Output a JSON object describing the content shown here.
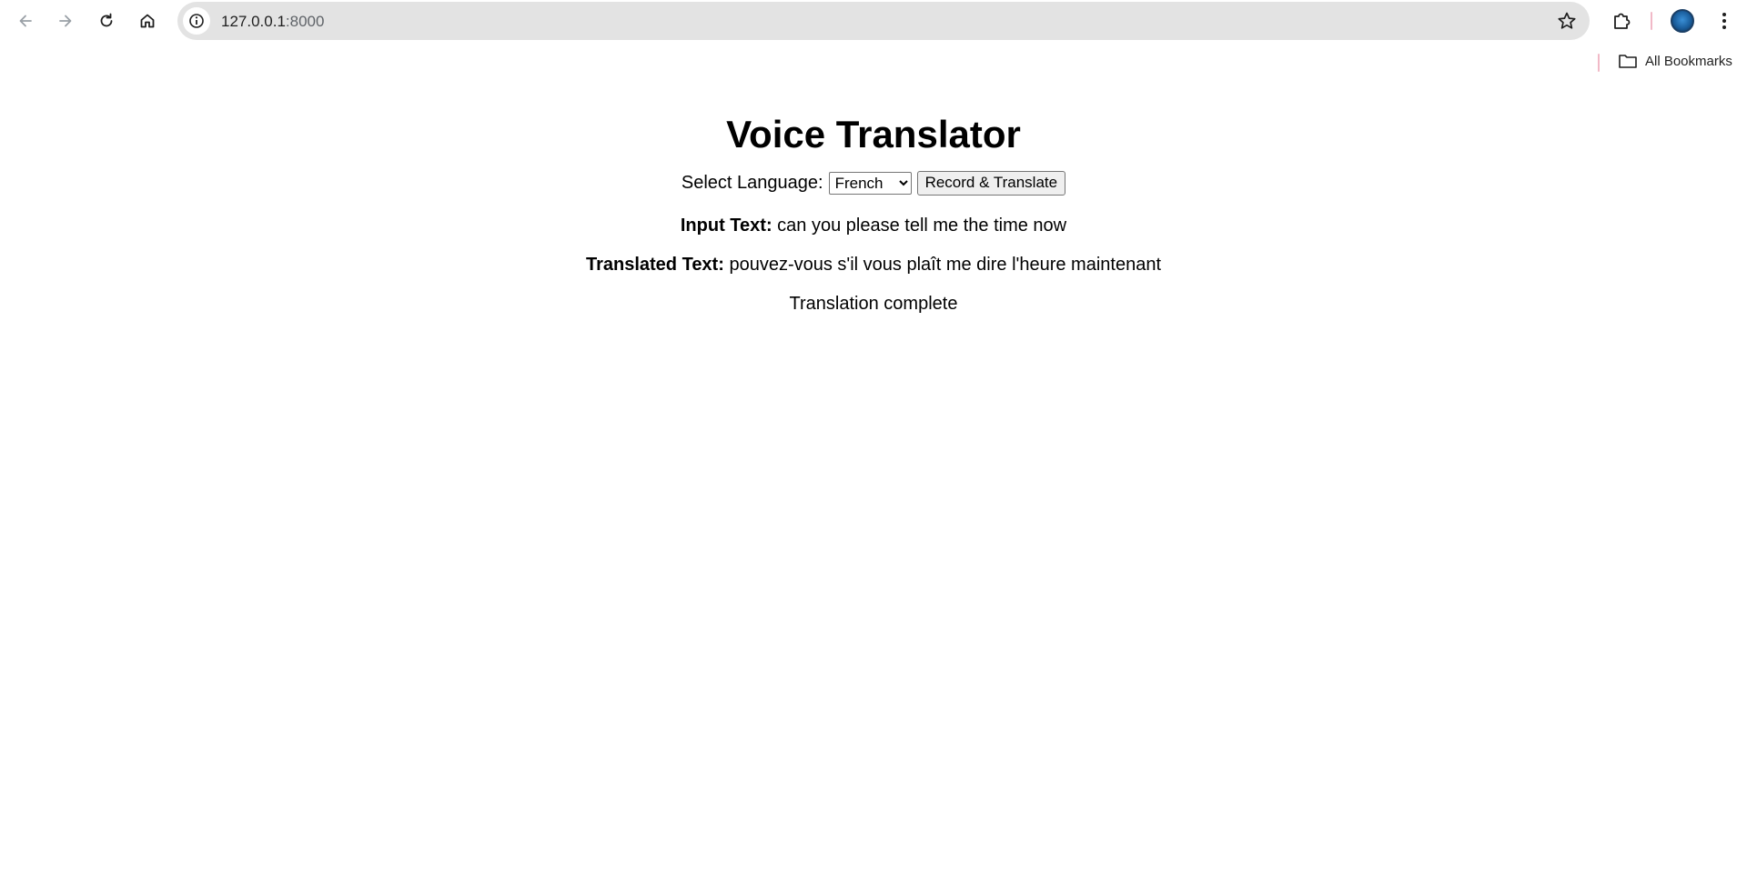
{
  "browser": {
    "url_host": "127.0.0.1",
    "url_port": ":8000",
    "bookmarks_label": "All Bookmarks",
    "icons": {
      "back": "arrow-left-icon",
      "forward": "arrow-right-icon",
      "reload": "reload-icon",
      "home": "home-icon",
      "site_info": "info-icon",
      "bookmark_star": "star-icon",
      "extensions": "puzzle-icon",
      "menu": "kebab-menu-icon",
      "folder": "folder-icon"
    },
    "colors": {
      "omnibox_bg": "#e3e3e3",
      "divider": "#f1b9c7",
      "avatar": "#1b5f9e"
    }
  },
  "page": {
    "title": "Voice Translator",
    "select_label": "Select Language:",
    "language_selected": "French",
    "record_button": "Record & Translate",
    "input_label": "Input Text:",
    "input_value": "can you please tell me the time now",
    "translated_label": "Translated Text:",
    "translated_value": "pouvez-vous s'il vous plaît me dire l'heure maintenant",
    "status": "Translation complete"
  }
}
